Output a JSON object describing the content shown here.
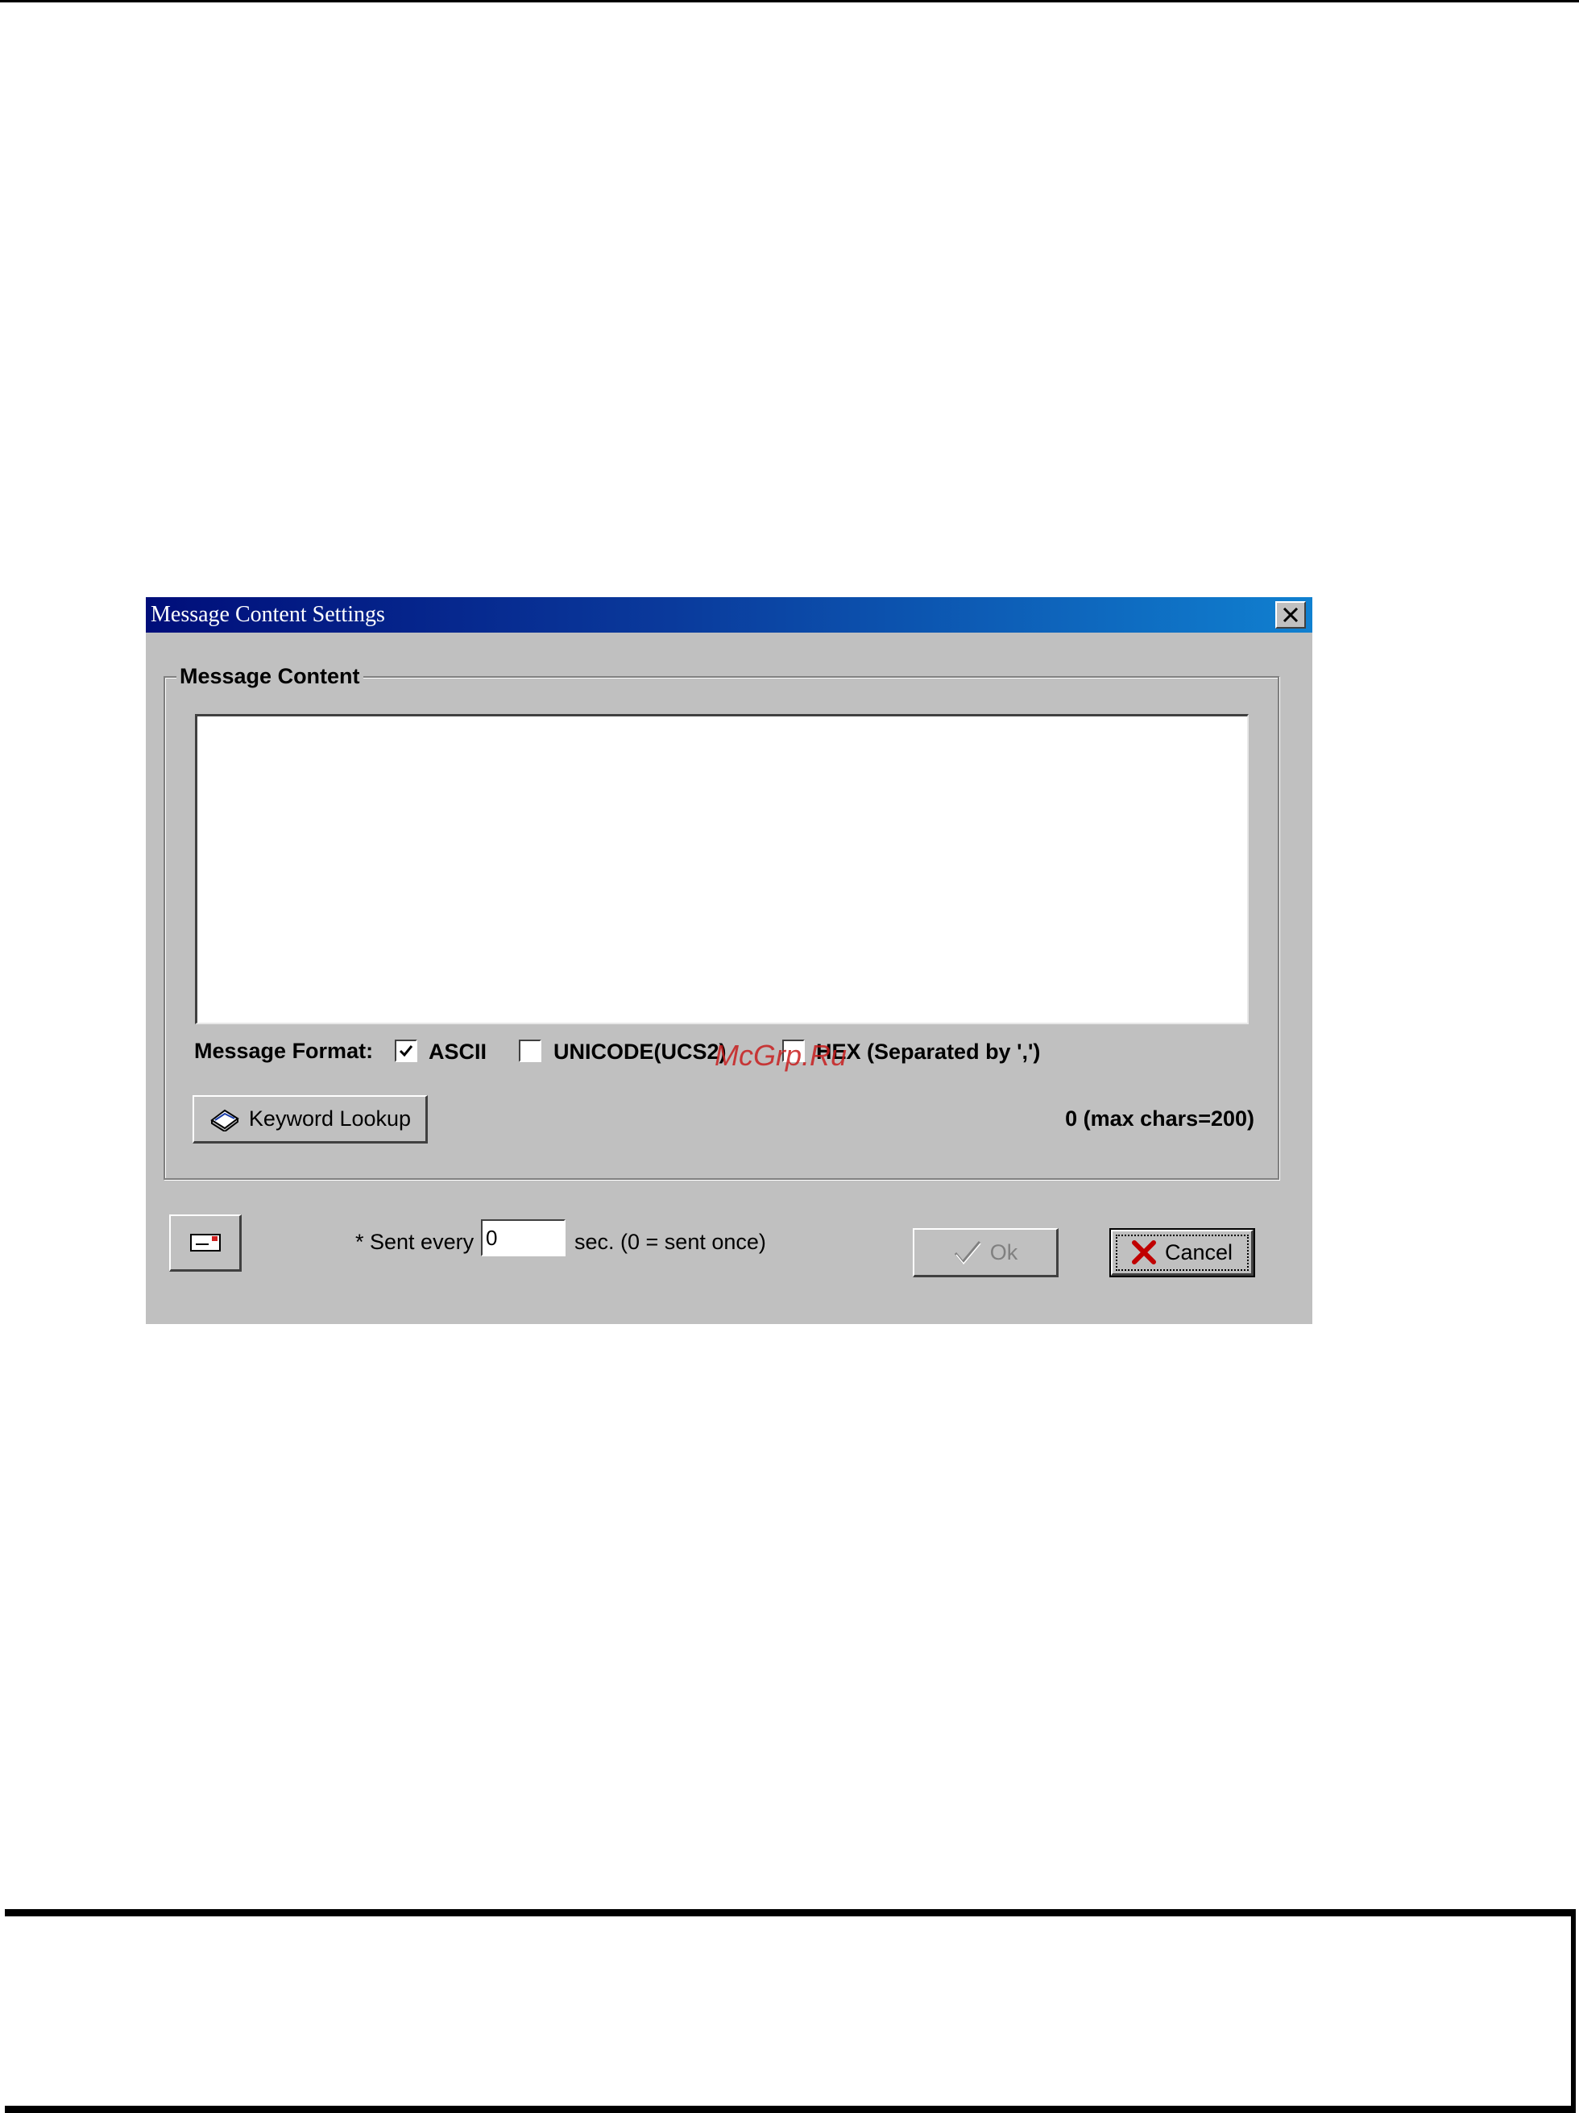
{
  "dialog": {
    "title": "Message Content Settings",
    "group_label": "Message Content",
    "message_text": "",
    "format": {
      "label": "Message Format:",
      "options": [
        {
          "label": "ASCII",
          "checked": true
        },
        {
          "label": "UNICODE(UCS2)",
          "checked": false
        },
        {
          "label": "HEX (Separated by ',')",
          "checked": false
        }
      ]
    },
    "keyword_lookup_label": "Keyword Lookup",
    "char_count": "0 (max chars=200)",
    "sent_every_label": "* Sent every",
    "interval_value": "0",
    "interval_suffix": "sec. (0 = sent once)",
    "ok_label": "Ok",
    "cancel_label": "Cancel"
  },
  "watermark": "McGrp.Ru",
  "colors": {
    "title_gradient_start": "#000e7a",
    "title_gradient_end": "#1080d0",
    "dialog_face": "#c0c0c0",
    "watermark": "#c81e1e"
  },
  "icons": {
    "close": "close-x-icon",
    "keyword": "book-icon",
    "message": "envelope-icon",
    "ok": "checkmark-icon",
    "cancel": "cancel-x-icon"
  }
}
